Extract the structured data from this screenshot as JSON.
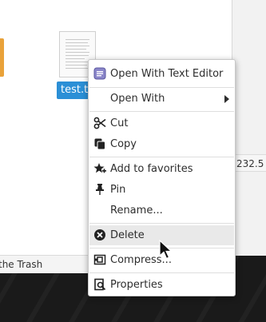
{
  "file": {
    "name": "test.txt"
  },
  "status_bar": {
    "text": "the Trash"
  },
  "side_panel": {
    "coordinate_value": "232.5"
  },
  "context_menu": {
    "items": [
      {
        "label": "Open With Text Editor",
        "icon": "text-editor-icon"
      },
      {
        "label": "Open With",
        "icon": "",
        "has_submenu": true
      },
      {
        "label": "Cut",
        "icon": "scissors-icon"
      },
      {
        "label": "Copy",
        "icon": "copy-icon"
      },
      {
        "label": "Add to favorites",
        "icon": "star-plus-icon"
      },
      {
        "label": "Pin",
        "icon": "pin-icon"
      },
      {
        "label": "Rename...",
        "icon": ""
      },
      {
        "label": "Delete",
        "icon": "delete-circle-icon",
        "hovered": true
      },
      {
        "label": "Compress...",
        "icon": "compress-icon"
      },
      {
        "label": "Properties",
        "icon": "properties-icon"
      }
    ]
  },
  "colors": {
    "selection": "#2b8fd6",
    "hover": "#e9e9e9",
    "folder": "#e9a23a"
  }
}
